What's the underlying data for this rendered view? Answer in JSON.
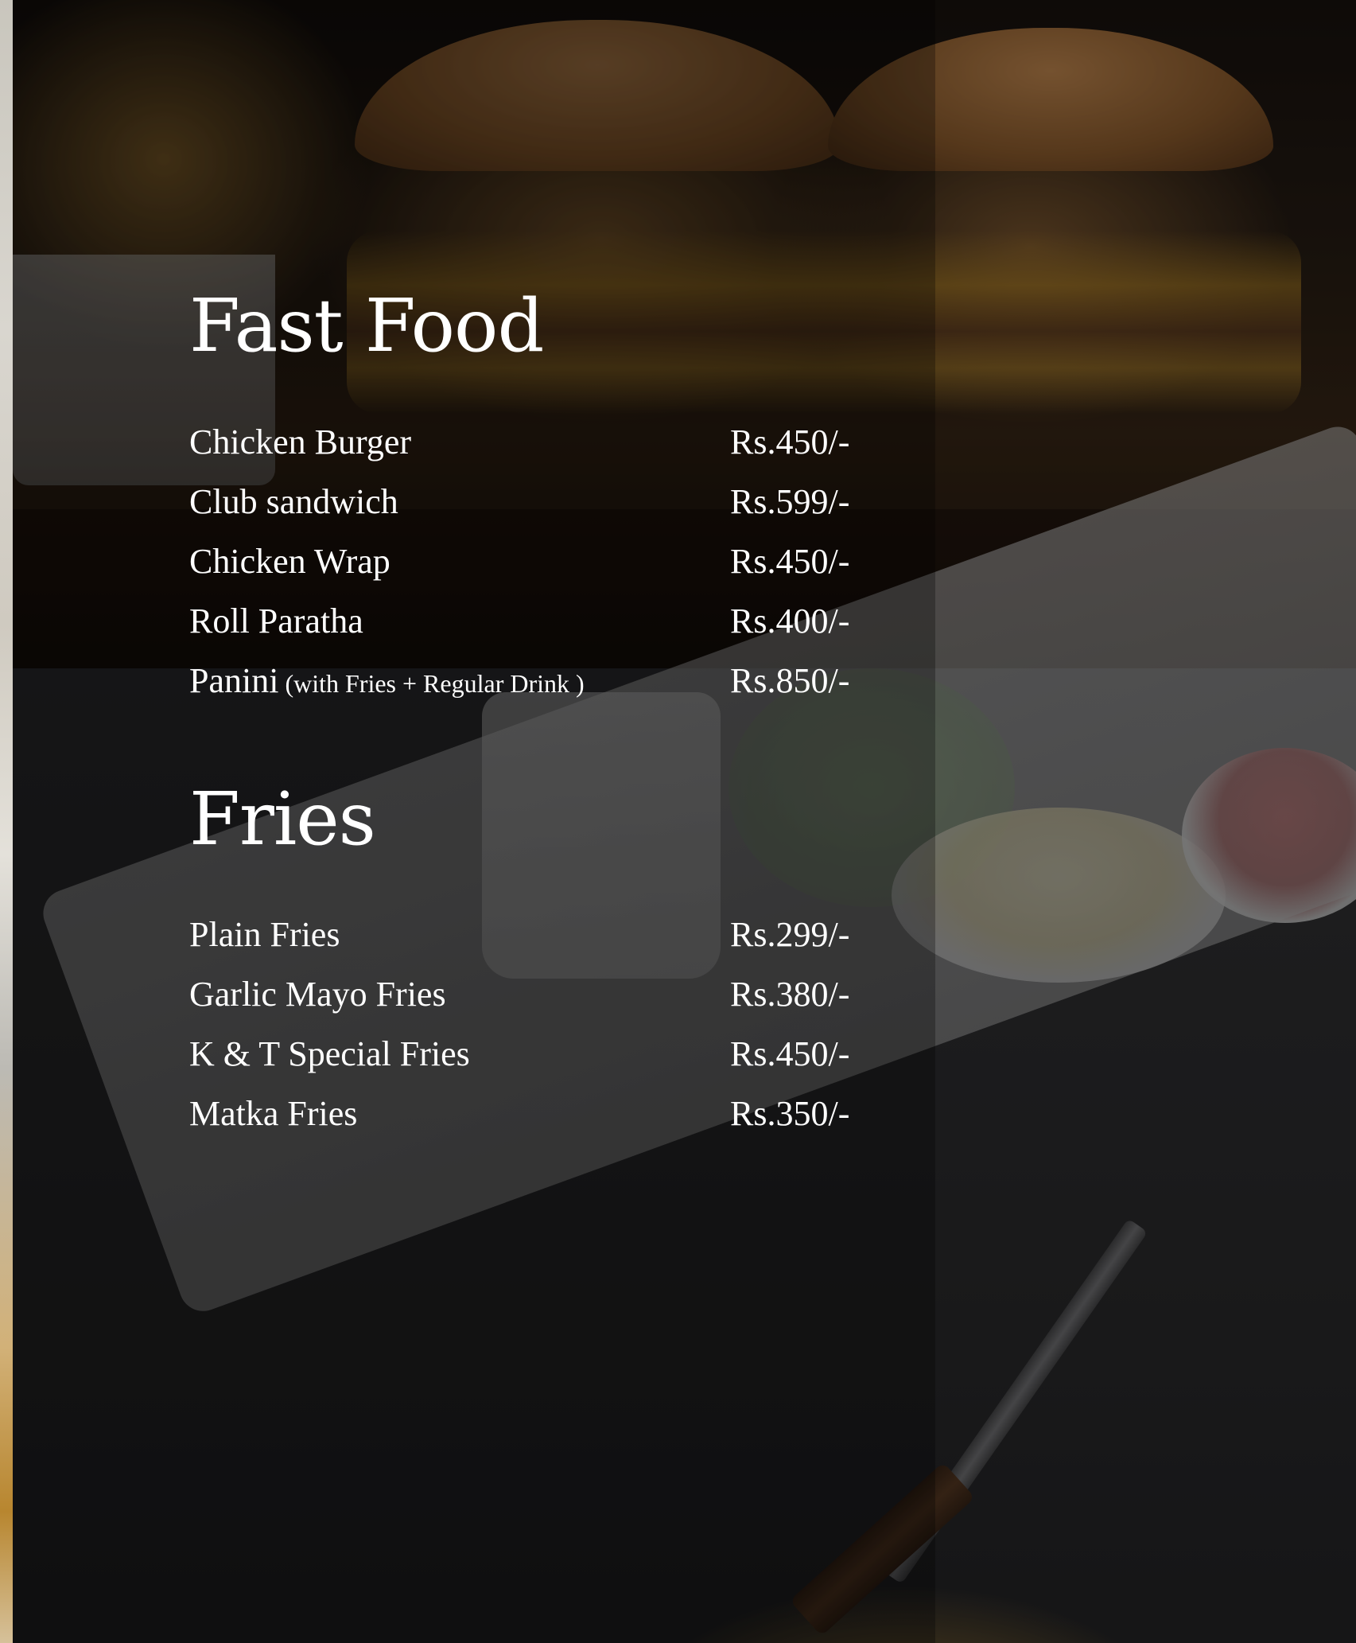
{
  "sections": [
    {
      "title": "Fast Food",
      "items": [
        {
          "name": "Chicken Burger",
          "note": "",
          "price": "Rs.450/-"
        },
        {
          "name": "Club sandwich",
          "note": "",
          "price": "Rs.599/-"
        },
        {
          "name": "Chicken Wrap",
          "note": "",
          "price": "Rs.450/-"
        },
        {
          "name": "Roll Paratha",
          "note": "",
          "price": "Rs.400/-"
        },
        {
          "name": "Panini",
          "note": " (with Fries + Regular Drink )",
          "price": "Rs.850/-"
        }
      ]
    },
    {
      "title": "Fries",
      "items": [
        {
          "name": "Plain Fries",
          "note": "",
          "price": "Rs.299/-"
        },
        {
          "name": "Garlic Mayo Fries",
          "note": "",
          "price": "Rs.380/-"
        },
        {
          "name": "K & T Special Fries",
          "note": "",
          "price": "Rs.450/-"
        },
        {
          "name": "Matka Fries",
          "note": "",
          "price": "Rs.350/-"
        }
      ]
    }
  ],
  "colors": {
    "text": "#ffffff",
    "background": "#1a1a1c"
  }
}
